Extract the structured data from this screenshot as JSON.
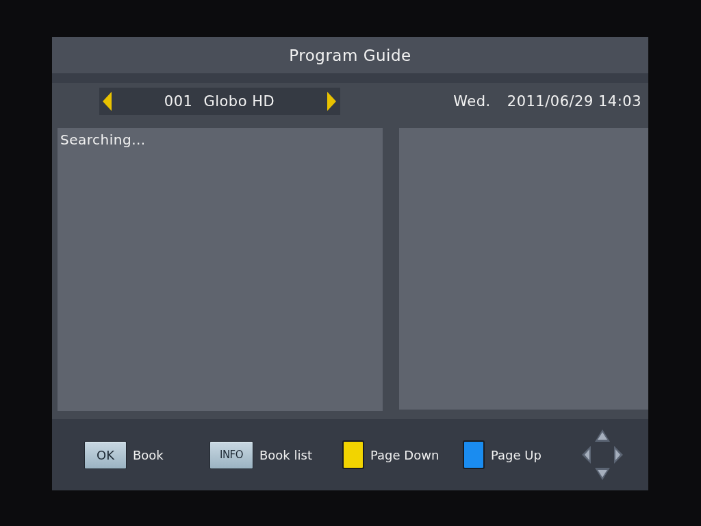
{
  "title": "Program Guide",
  "channel": {
    "number": "001",
    "name": "Globo HD"
  },
  "clock": {
    "day": "Wed.",
    "datetime": "2011/06/29 14:03"
  },
  "event_list": {
    "status": "Searching..."
  },
  "key_hints": [
    {
      "kind": "key",
      "key": "OK",
      "label": "Book"
    },
    {
      "kind": "key",
      "key": "INFO",
      "label": "Book list"
    },
    {
      "kind": "color",
      "color": "#f2d400",
      "label": "Page Down"
    },
    {
      "kind": "color",
      "color": "#1a8cf0",
      "label": "Page Up"
    }
  ]
}
